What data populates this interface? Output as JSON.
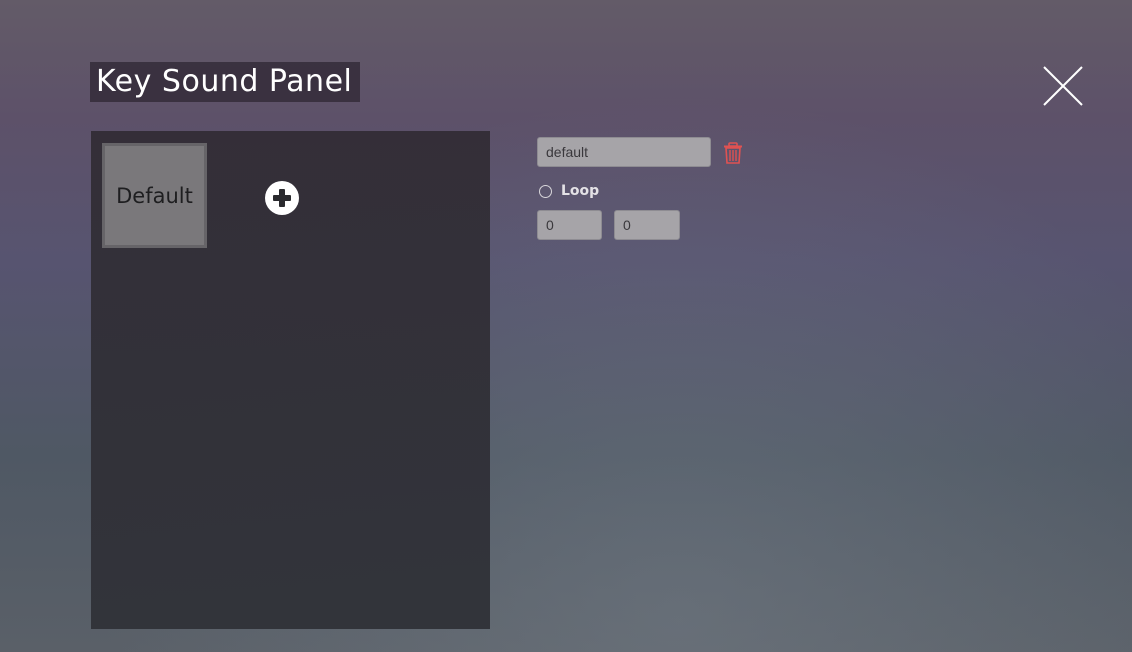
{
  "panel": {
    "title": "Key Sound Panel"
  },
  "sound_list": {
    "items": [
      {
        "label": "Default"
      }
    ]
  },
  "editor": {
    "name_value": "default",
    "loop_label": "Loop",
    "loop_checked": false,
    "values": [
      "0",
      "0"
    ]
  },
  "colors": {
    "delete_icon": "#e05252",
    "panel_background": "#323036"
  }
}
